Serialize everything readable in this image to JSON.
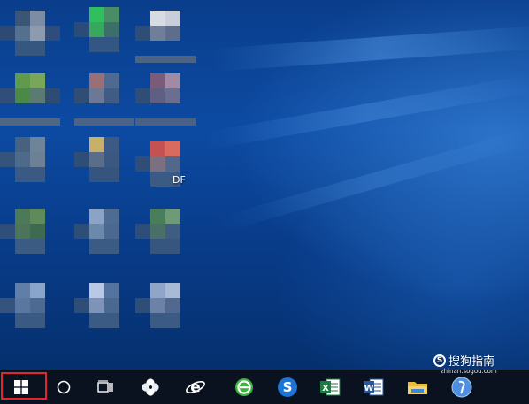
{
  "desktop": {
    "visible_text": "DF"
  },
  "taskbar": {
    "items": [
      {
        "name": "start-button",
        "icon": "windows-logo-icon"
      },
      {
        "name": "search-button",
        "icon": "cortana-circle-icon"
      },
      {
        "name": "task-view-button",
        "icon": "task-view-icon"
      },
      {
        "name": "pinwheel-app",
        "icon": "pinwheel-icon"
      },
      {
        "name": "internet-explorer",
        "icon": "ie-icon"
      },
      {
        "name": "green-browser",
        "icon": "green-e-icon"
      },
      {
        "name": "sogou-browser",
        "icon": "sogou-s-icon"
      },
      {
        "name": "excel",
        "icon": "excel-icon"
      },
      {
        "name": "word",
        "icon": "word-icon"
      },
      {
        "name": "file-explorer",
        "icon": "folder-icon"
      },
      {
        "name": "globe-app",
        "icon": "globe-icon"
      }
    ]
  },
  "watermark": {
    "label": "搜狗指南",
    "url": "zhinan.sogou.com"
  },
  "colors": {
    "highlight": "#e0262f",
    "taskbar": "#0a1220"
  }
}
